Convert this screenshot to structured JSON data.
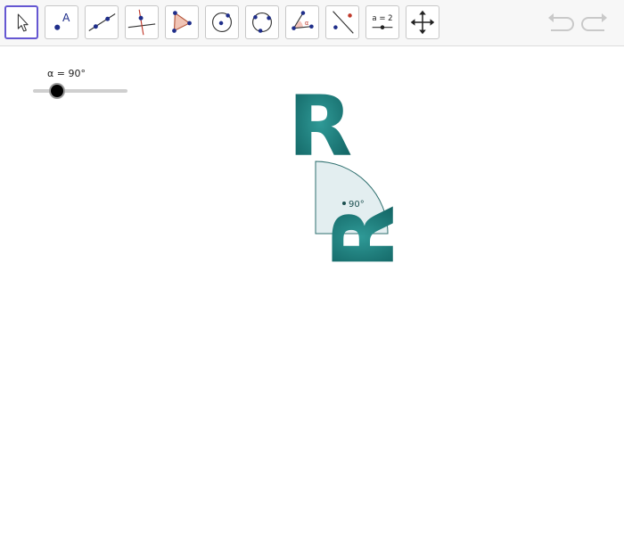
{
  "toolbar": {
    "tools": [
      {
        "name": "move-tool",
        "icon": "cursor-arrow-icon",
        "active": true
      },
      {
        "name": "point-tool",
        "icon": "point-with-label-icon",
        "label": "A"
      },
      {
        "name": "line-tool",
        "icon": "line-through-two-points-icon"
      },
      {
        "name": "perpendicular-line-tool",
        "icon": "perpendicular-line-icon"
      },
      {
        "name": "polygon-tool",
        "icon": "polygon-icon"
      },
      {
        "name": "circle-tool",
        "icon": "circle-center-point-icon"
      },
      {
        "name": "circle-through-points-tool",
        "icon": "circle-three-points-icon"
      },
      {
        "name": "angle-tool",
        "icon": "angle-icon",
        "label": "α"
      },
      {
        "name": "reflect-tool",
        "icon": "reflect-about-line-icon"
      },
      {
        "name": "slider-tool",
        "icon": "slider-icon",
        "label": "a = 2"
      },
      {
        "name": "move-graphics-view-tool",
        "icon": "move-graphics-view-icon"
      }
    ],
    "undo_icon": "undo-icon",
    "redo_icon": "redo-icon"
  },
  "slider": {
    "label": "α = 90°",
    "min": 0,
    "max": 360,
    "value": 90
  },
  "canvas": {
    "angle_label": "90°",
    "original_letter": "R",
    "rotated_letter": "R",
    "colors": {
      "letter": "#1b7a78",
      "sector_fill": "#e3eef0",
      "sector_stroke": "#2e6f6e",
      "accent": "#6557d2"
    }
  }
}
